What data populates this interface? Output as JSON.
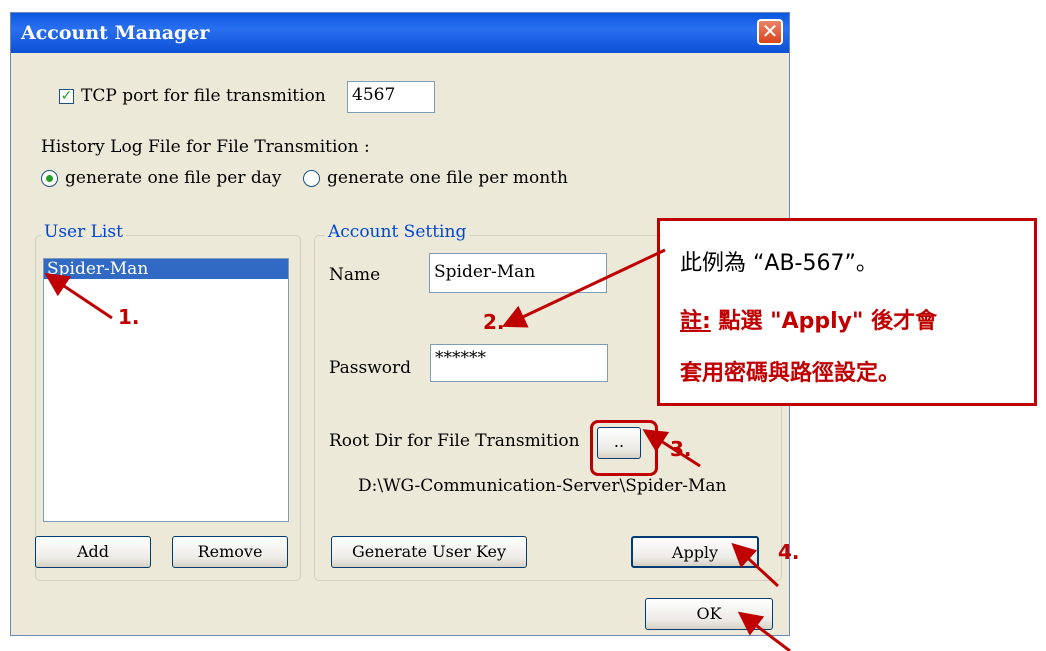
{
  "dialog": {
    "title": "Account Manager",
    "close_glyph": "✕",
    "tcp": {
      "checked": true,
      "label": "TCP port for file transmition",
      "value": "4567"
    },
    "history": {
      "label": "History Log File for File Transmition :",
      "options": [
        "generate one file per day",
        "generate one file per month"
      ],
      "selected": "generate one file per day"
    },
    "user_list": {
      "legend": "User List",
      "items": [
        "Spider-Man"
      ],
      "selected": "Spider-Man",
      "add_label": "Add",
      "remove_label": "Remove"
    },
    "account_setting": {
      "legend": "Account Setting",
      "name_label": "Name",
      "name_value": "Spider-Man",
      "password_label": "Password",
      "password_value": "******",
      "root_dir_label": "Root Dir for File Transmition",
      "browse_label": "..",
      "root_dir_path": "D:\\WG-Communication-Server\\Spider-Man",
      "generate_key_label": "Generate User Key",
      "apply_label": "Apply"
    },
    "ok_label": "OK"
  },
  "annotations": {
    "callout_line1": "此例為 “AB-567”。",
    "callout_note_prefix": "註:",
    "callout_note_rest": " 點選 \"Apply\" 後才會",
    "callout_line3": "套用密碼與路徑設定。",
    "steps": [
      "1.",
      "2.",
      "3.",
      "4."
    ],
    "color": "#c00000"
  }
}
